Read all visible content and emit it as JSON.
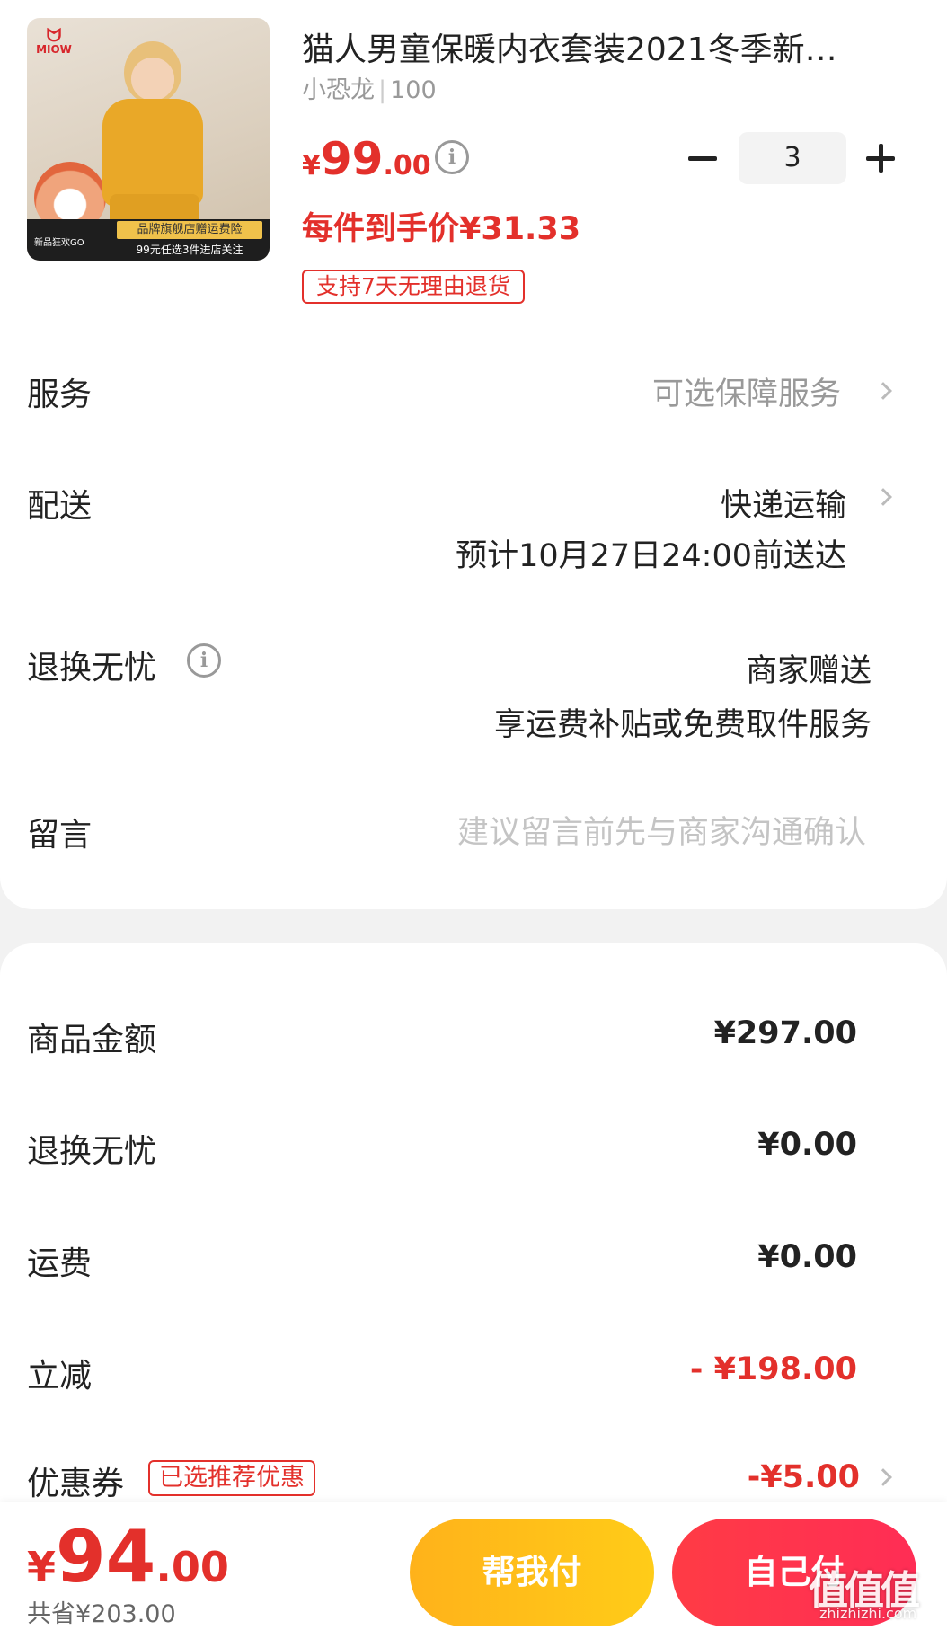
{
  "product": {
    "title": "猫人男童保暖内衣套装2021冬季新…",
    "spec": "小恐龙",
    "size": "100",
    "price_currency": "¥",
    "price_int": "99",
    "price_dec": ".00",
    "per_item_price": "每件到手价¥31.33",
    "quantity": "3",
    "return_tag": "支持7天无理由退货",
    "thumb": {
      "brand": "MIOW",
      "promo_left": "新品狂欢GO",
      "promo_right_top": "品牌旗舰店赠运费险",
      "promo_right_bottom": "99元任选3件进店关注"
    }
  },
  "rows": {
    "service_label": "服务",
    "service_value": "可选保障服务",
    "delivery_label": "配送",
    "delivery_value": "快递运输",
    "delivery_eta": "预计10月27日24:00前送达",
    "worry_label": "退换无忧",
    "worry_value": "商家赠送",
    "worry_desc": "享运费补贴或免费取件服务",
    "message_label": "留言",
    "message_placeholder": "建议留言前先与商家沟通确认"
  },
  "summary": {
    "goods_label": "商品金额",
    "goods_value": "¥297.00",
    "worry_label": "退换无忧",
    "worry_value": "¥0.00",
    "shipping_label": "运费",
    "shipping_value": "¥0.00",
    "discount_label": "立减",
    "discount_value": "- ¥198.00",
    "coupon_label": "优惠券",
    "coupon_tag": "已选推荐优惠",
    "coupon_value": "-¥5.00"
  },
  "bottom": {
    "total_currency": "¥",
    "total_int": "94",
    "total_dec": ".00",
    "saved": "共省¥203.00",
    "help_pay": "帮我付",
    "self_pay": "自己付",
    "watermark": "值值值",
    "watermark_url": "zhizhizhi.com"
  },
  "colors": {
    "accent_red": "#e3302b",
    "help_button": "#ffb21a",
    "self_button": "#ff3b45"
  }
}
